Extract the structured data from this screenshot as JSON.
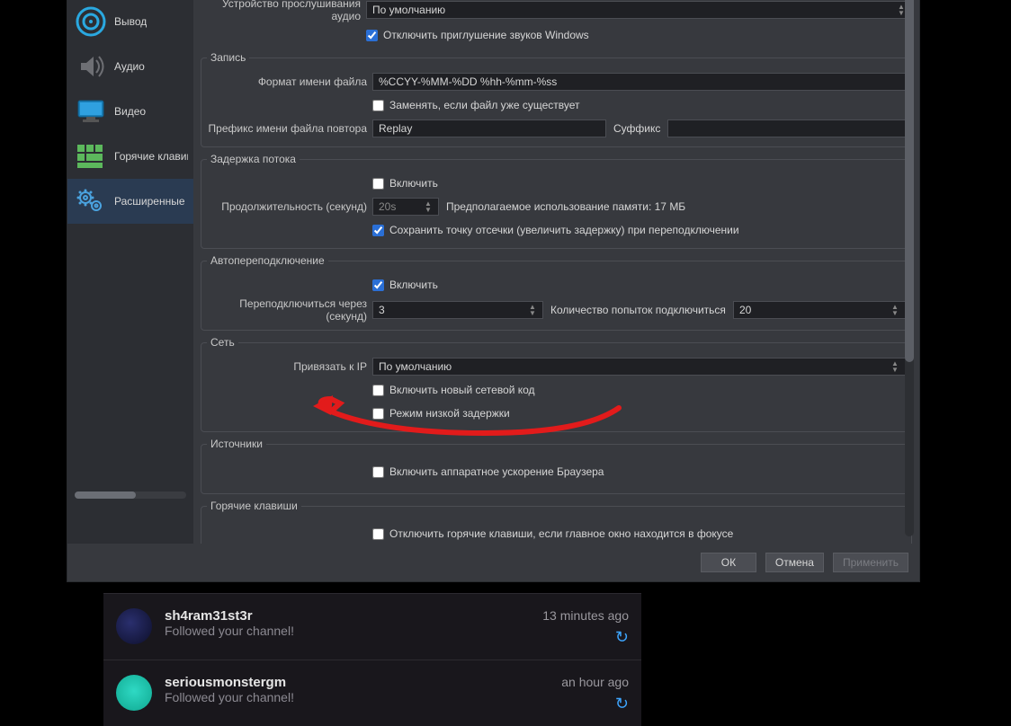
{
  "sidebar": {
    "items": [
      {
        "label": "Вывод"
      },
      {
        "label": "Аудио"
      },
      {
        "label": "Видео"
      },
      {
        "label": "Горячие клавиши"
      },
      {
        "label": "Расширенные"
      }
    ]
  },
  "audio": {
    "listen_device_label": "Устройство прослушивания аудио",
    "listen_device_value": "По умолчанию",
    "disable_ducking": "Отключить приглушение звуков Windows"
  },
  "recording": {
    "legend": "Запись",
    "filename_format_label": "Формат имени файла",
    "filename_format_value": "%CCYY-%MM-%DD %hh-%mm-%ss",
    "overwrite": "Заменять, если файл уже существует",
    "replay_prefix_label": "Префикс имени файла повтора",
    "replay_prefix_value": "Replay",
    "suffix_label": "Суффикс",
    "suffix_value": ""
  },
  "delay": {
    "legend": "Задержка потока",
    "enable": "Включить",
    "duration_label": "Продолжительность (секунд)",
    "duration_value": "20s",
    "memory_label": "Предполагаемое использование памяти: 17 МБ",
    "preserve": "Сохранить точку отсечки (увеличить задержку) при переподключении"
  },
  "reconnect": {
    "legend": "Автопереподключение",
    "enable": "Включить",
    "retry_delay_label": "Переподключиться через (секунд)",
    "retry_delay_value": "3",
    "max_retries_label": "Количество попыток подключиться",
    "max_retries_value": "20"
  },
  "network": {
    "legend": "Сеть",
    "bind_ip_label": "Привязать к IP",
    "bind_ip_value": "По умолчанию",
    "new_netcode": "Включить новый сетевой код",
    "low_latency": "Режим низкой задержки"
  },
  "sources": {
    "legend": "Источники",
    "hw_accel": "Включить аппаратное ускорение Браузера"
  },
  "hotkeys": {
    "legend": "Горячие клавиши",
    "disable_when_focus": "Отключить горячие клавиши, если главное окно находится в фокусе"
  },
  "buttons": {
    "ok": "ОК",
    "cancel": "Отмена",
    "apply": "Применить"
  },
  "feed": [
    {
      "name": "sh4ram31st3r",
      "sub": "Followed your channel!",
      "time": "13 minutes ago"
    },
    {
      "name": "seriousmonstergm",
      "sub": "Followed your channel!",
      "time": "an hour ago"
    }
  ]
}
